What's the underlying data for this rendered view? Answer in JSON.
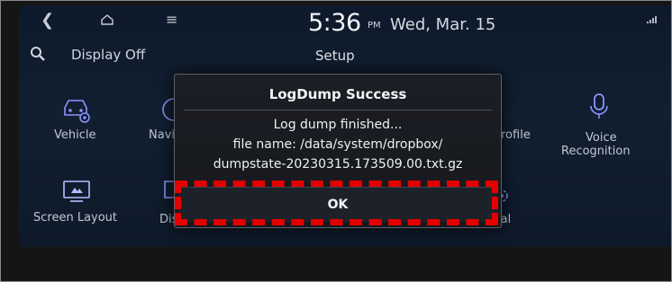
{
  "status_bar": {
    "time": "5:36",
    "ampm": "PM",
    "date": "Wed, Mar. 15"
  },
  "header": {
    "display_off": "Display Off",
    "title": "Setup"
  },
  "apps": {
    "row1": [
      {
        "label": "Vehicle",
        "icon": "car-settings-icon"
      },
      {
        "label": "Navi",
        "icon": "navigation-icon"
      },
      {
        "label": "rofile",
        "icon": "profile-icon"
      },
      {
        "label": "Voice",
        "label2": "Recognition",
        "icon": "microphone-icon"
      }
    ],
    "row2": [
      {
        "label": "Screen Layout",
        "icon": "screen-layout-icon"
      },
      {
        "label": "Display",
        "icon": "display-icon"
      },
      {
        "label": "General",
        "icon": "gear-icon"
      }
    ]
  },
  "dialog": {
    "title": "LogDump Success",
    "line1": "Log dump finished...",
    "line2": "file name: /data/system/dropbox/",
    "line3": "dumpstate-20230315.173509.00.txt.gz",
    "ok_label": "OK"
  },
  "colors": {
    "highlight": "#e40000",
    "screen_bg": "#0d1a2c",
    "dialog_bg": "#1b1e24"
  }
}
